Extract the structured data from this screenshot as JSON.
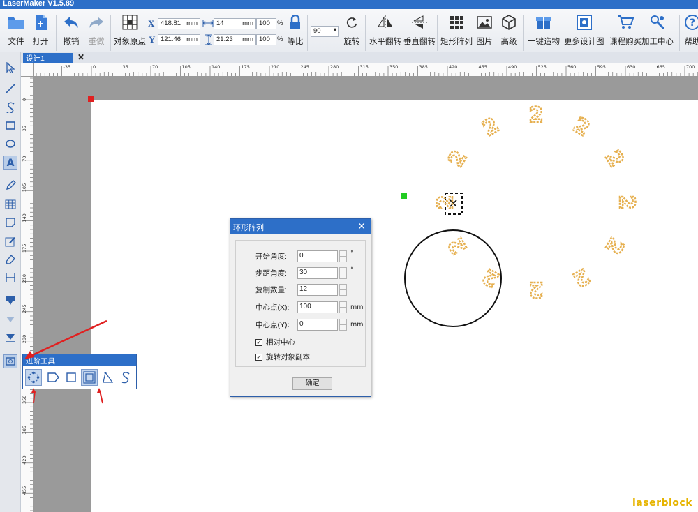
{
  "app": {
    "title": "LaserMaker V1.5.89"
  },
  "toolbar": {
    "file": "文件",
    "open": "打开",
    "undo": "撤销",
    "redo": "重做",
    "origin": "对象原点",
    "x_value": "418.81",
    "x_unit": "mm",
    "y_value": "121.46",
    "y_unit": "mm",
    "width_value": "14",
    "width_unit": "mm",
    "height_value": "21.23",
    "height_unit": "mm",
    "scale_w": "100",
    "scale_h": "100",
    "percent": "%",
    "lock_ratio": "等比",
    "rotate_value": "90",
    "rotate": "旋转",
    "flip_h": "水平翻转",
    "flip_v": "垂直翻转",
    "rect_array": "矩形阵列",
    "picture": "图片",
    "advanced": "高级",
    "one_click": "一键造物",
    "more_designs": "更多设计图",
    "course": "课程购买",
    "process_center": "加工中心",
    "help": "帮助"
  },
  "axis_labels": {
    "x": "X",
    "y": "Y"
  },
  "document_tab": {
    "label": "设计1",
    "close": "✕"
  },
  "ruler": {
    "top_ticks": [
      "-35",
      "0",
      "35",
      "70",
      "105",
      "140",
      "175",
      "210",
      "245",
      "280",
      "315",
      "350",
      "385",
      "420",
      "455",
      "490",
      "525",
      "560",
      "595",
      "630",
      "665",
      "700"
    ],
    "left_ticks": [
      "0",
      "35",
      "70",
      "105",
      "140",
      "175",
      "210",
      "245",
      "280",
      "315",
      "350",
      "385",
      "420",
      "455"
    ]
  },
  "canvas": {
    "array_glyph": "2",
    "array_count": 12
  },
  "dialog": {
    "title": "环形阵列",
    "close": "✕",
    "start_angle_label": "开始角度:",
    "start_angle_value": "0",
    "start_angle_unit": "°",
    "step_angle_label": "步距角度:",
    "step_angle_value": "30",
    "step_angle_unit": "°",
    "copies_label": "复制数量:",
    "copies_value": "12",
    "center_x_label": "中心点(X):",
    "center_x_value": "100",
    "center_x_unit": "mm",
    "center_y_label": "中心点(Y):",
    "center_y_value": "0",
    "center_y_unit": "mm",
    "relative_center": "相对中心",
    "relative_center_checked": true,
    "rotate_copies": "旋转对象副本",
    "rotate_copies_checked": true,
    "ok": "确定"
  },
  "advanced_tools": {
    "title": "进阶工具"
  },
  "check_mark": "✓",
  "watermark": "laserblock",
  "colors": {
    "titlebar": "#2d6fc8",
    "glyph_fill": "#e6b050",
    "selection_green": "#22cc22",
    "origin_red": "#e02020",
    "annotation_arrow": "#e02020"
  }
}
